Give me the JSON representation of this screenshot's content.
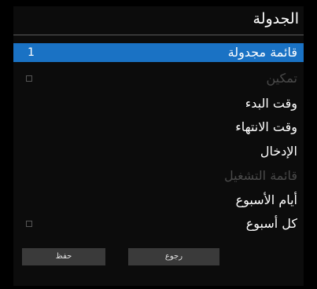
{
  "title": "الجدولة",
  "items": [
    {
      "label": "قائمة مجدولة",
      "value": "1"
    },
    {
      "label": "تمكين"
    },
    {
      "label": "وقت البدء"
    },
    {
      "label": "وقت الانتهاء"
    },
    {
      "label": "الإدخال"
    },
    {
      "label": "قائمة التشغيل"
    },
    {
      "label": "أيام الأسبوع"
    },
    {
      "label": "كل أسبوع"
    }
  ],
  "buttons": {
    "save": "حفظ",
    "back": "رجوع"
  },
  "colors": {
    "accent": "#1a72c4",
    "background": "#0c0c0c",
    "disabled_text": "#4a4a4a"
  }
}
